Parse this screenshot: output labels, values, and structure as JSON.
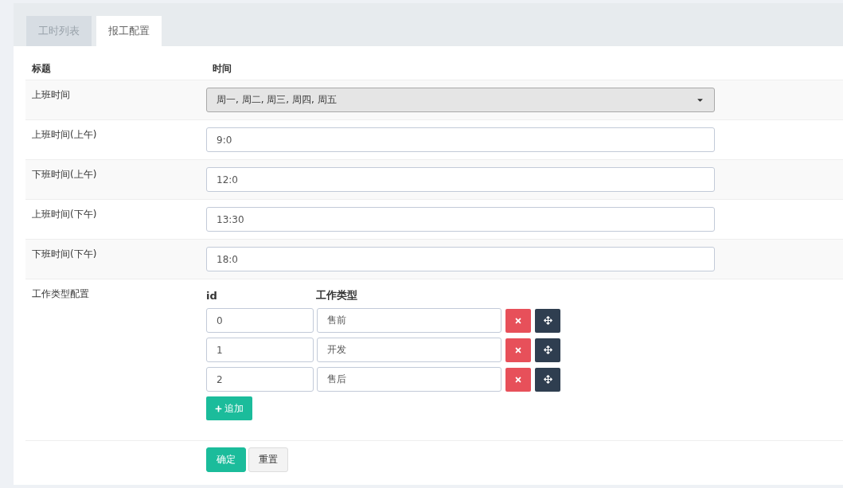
{
  "tabs": [
    {
      "label": "工时列表",
      "selected": false
    },
    {
      "label": "报工配置",
      "selected": true
    }
  ],
  "table": {
    "columns": [
      "标题",
      "时间"
    ],
    "rows": [
      {
        "label": "上班时间",
        "kind": "select",
        "value": "周一, 周二, 周三, 周四, 周五"
      },
      {
        "label": "上班时间(上午)",
        "kind": "input",
        "value": "9:0"
      },
      {
        "label": "下班时间(上午)",
        "kind": "input",
        "value": "12:0"
      },
      {
        "label": "上班时间(下午)",
        "kind": "input",
        "value": "13:30"
      },
      {
        "label": "下班时间(下午)",
        "kind": "input",
        "value": "18:0"
      }
    ]
  },
  "work_types": {
    "label": "工作类型配置",
    "columns": [
      "id",
      "工作类型"
    ],
    "items": [
      {
        "id": "0",
        "type": "售前"
      },
      {
        "id": "1",
        "type": "开发"
      },
      {
        "id": "2",
        "type": "售后"
      }
    ],
    "add_button": "追加"
  },
  "buttons": {
    "submit": "确定",
    "reset": "重置"
  }
}
